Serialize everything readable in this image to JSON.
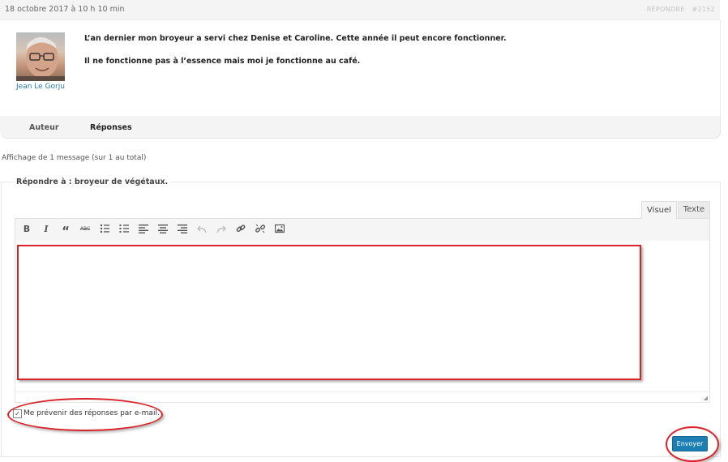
{
  "reply": {
    "date": "18 octobre 2017 à 10 h 10 min",
    "action_label": "RÉPONDRE",
    "id": "#2152",
    "author": "Jean Le Gorju",
    "paragraphs": [
      "L’an dernier mon broyeur a servi chez Denise et Caroline. Cette année il peut encore fonctionner.",
      "Il ne fonctionne pas à l’essence mais moi je fonctionne au café."
    ]
  },
  "footer": {
    "author_label": "Auteur",
    "replies_label": "Réponses"
  },
  "pagination": {
    "count_text": "Affichage de 1 message (sur 1 au total)"
  },
  "form": {
    "legend": "Répondre à : broyeur de végétaux.",
    "tabs": {
      "visual": "Visuel",
      "text": "Texte"
    },
    "toolbar": [
      {
        "name": "bold",
        "glyph": "B"
      },
      {
        "name": "italic",
        "glyph": "I"
      },
      {
        "name": "quote",
        "glyph": "“"
      },
      {
        "name": "strikethrough",
        "glyph": "ABC"
      },
      {
        "name": "bullet-list",
        "glyph": "list"
      },
      {
        "name": "numbered-list",
        "glyph": "olist"
      },
      {
        "name": "align-left",
        "glyph": "al"
      },
      {
        "name": "align-center",
        "glyph": "ac"
      },
      {
        "name": "align-right",
        "glyph": "ar"
      },
      {
        "name": "undo",
        "glyph": "undo"
      },
      {
        "name": "redo",
        "glyph": "redo"
      },
      {
        "name": "link",
        "glyph": "link"
      },
      {
        "name": "unlink",
        "glyph": "unlink"
      },
      {
        "name": "image",
        "glyph": "img"
      }
    ],
    "notify_label": "Me prévenir des réponses par e-mail.",
    "notify_checked": true,
    "submit_label": "Envoyer"
  },
  "colors": {
    "accent": "#1c7fb3",
    "annotation": "#d8232a",
    "link": "#2a7ab0"
  }
}
